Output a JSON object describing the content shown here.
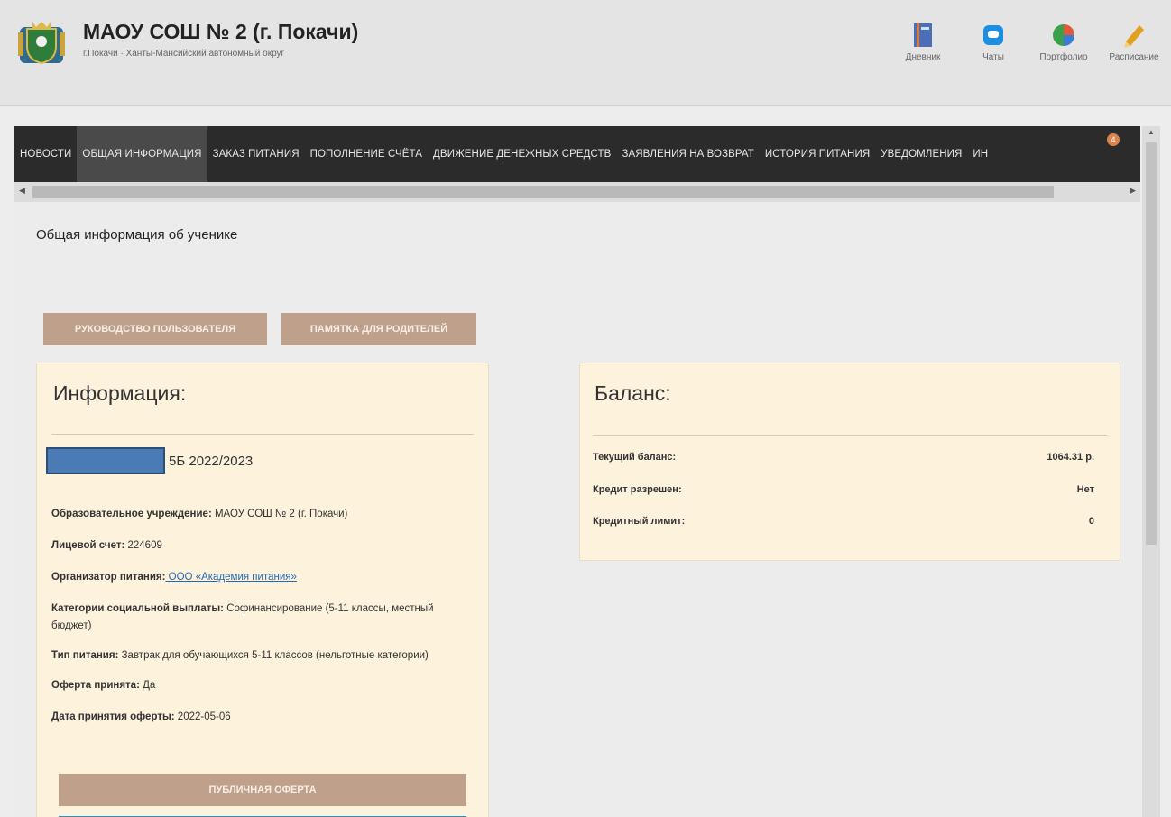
{
  "header": {
    "school_name": "МАОУ СОШ № 2 (г. Покачи)",
    "region": "г.Покачи · Ханты-Мансийский автономный округ",
    "links": [
      {
        "label": "Дневник",
        "icon": "diary-icon"
      },
      {
        "label": "Чаты",
        "icon": "chat-icon"
      },
      {
        "label": "Портфолио",
        "icon": "portfolio-icon"
      },
      {
        "label": "Расписание",
        "icon": "schedule-icon"
      }
    ]
  },
  "nav": {
    "items": [
      "НОВОСТИ",
      "ОБЩАЯ ИНФОРМАЦИЯ",
      "ЗАКАЗ ПИТАНИЯ",
      "ПОПОЛНЕНИЕ СЧЁТА",
      "ДВИЖЕНИЕ ДЕНЕЖНЫХ СРЕДСТВ",
      "ЗАЯВЛЕНИЯ НА ВОЗВРАТ",
      "ИСТОРИЯ ПИТАНИЯ",
      "УВЕДОМЛЕНИЯ",
      "ИН"
    ],
    "active_index": 1,
    "notifications_badge": "4"
  },
  "page": {
    "title": "Общая информация об ученике",
    "buttons": {
      "user_guide": "РУКОВОДСТВО ПОЛЬЗОВАТЕЛЯ",
      "parents_memo": "ПАМЯТКА ДЛЯ РОДИТЕЛЕЙ"
    }
  },
  "info_card": {
    "heading": "Информация:",
    "class_year": "5Б 2022/2023",
    "fields": {
      "school_label": "Образовательное учреждение:",
      "school_value": " МАОУ СОШ № 2 (г. Покачи)",
      "account_label": "Лицевой счет:",
      "account_value": " 224609",
      "organizer_label": "Организатор питания:",
      "organizer_value": " ООО «Академия питания»",
      "category_label": "Категории социальной выплаты:",
      "category_value": " Софинансирование (5-11 классы, местный бюджет)",
      "meal_label": "Тип питания:",
      "meal_value": " Завтрак для обучающихся 5-11 классов (нельготные категории)",
      "offer_label": "Оферта принята:",
      "offer_value": " Да",
      "offer_date_label": "Дата принятия оферты:",
      "offer_date_value": " 2022-05-06"
    },
    "public_offer_button": "ПУБЛИЧНАЯ ОФЕРТА"
  },
  "balance_card": {
    "heading": "Баланс:",
    "rows": [
      {
        "label": "Текущий баланс:",
        "value": "1064.31 р."
      },
      {
        "label": "Кредит разрешен:",
        "value": "Нет"
      },
      {
        "label": "Кредитный лимит:",
        "value": "0"
      }
    ]
  },
  "colors": {
    "nav_bg": "#2b2b2b",
    "button_tan": "#bfa18b",
    "card_bg": "#fdf2dc",
    "redaction": "#4a7bb5",
    "link": "#2469b3"
  }
}
